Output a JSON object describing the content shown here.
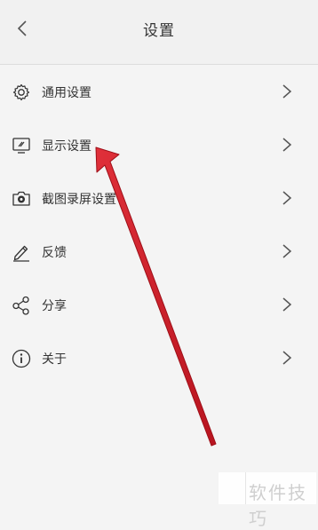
{
  "header": {
    "title": "设置",
    "back_icon": "chevron-left-icon"
  },
  "menu": [
    {
      "label": "通用设置",
      "icon": "gear-icon"
    },
    {
      "label": "显示设置",
      "icon": "monitor-icon"
    },
    {
      "label": "截图录屏设置",
      "icon": "camera-icon"
    },
    {
      "label": "反馈",
      "icon": "pencil-icon"
    },
    {
      "label": "分享",
      "icon": "share-icon"
    },
    {
      "label": "关于",
      "icon": "info-icon"
    }
  ],
  "annotation": {
    "color": "#d8202c",
    "points_to": "显示设置"
  },
  "watermark": {
    "text": "软件技巧"
  }
}
